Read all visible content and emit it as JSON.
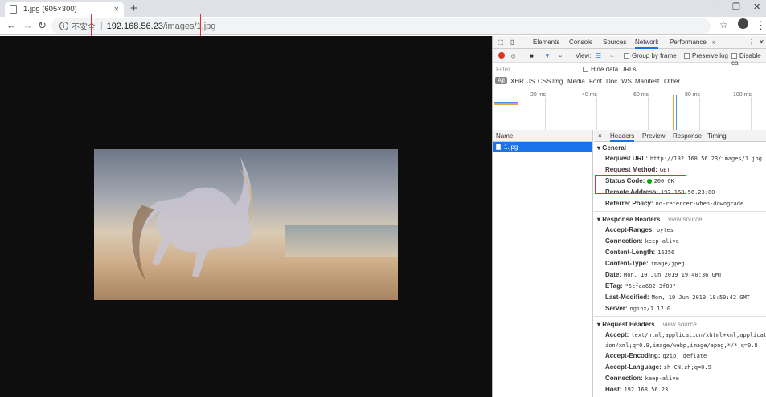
{
  "tab": {
    "title": "1.jpg (605×300)",
    "close": "×"
  },
  "newtab": "+",
  "window": {
    "minimize": "─",
    "restore": "❐",
    "close": "✕"
  },
  "toolbar": {
    "back": "←",
    "forward": "→",
    "reload": "↻",
    "insecure": "不安全",
    "separator": "|",
    "url_host": "192.168.56.23",
    "url_path": "/images/1.jpg",
    "star": "☆",
    "menu": "⋮"
  },
  "devtools": {
    "tabs": [
      "Elements",
      "Console",
      "Sources",
      "Network",
      "Performance",
      "»"
    ],
    "view_label": "View:",
    "group_by_frame": "Group by frame",
    "preserve_log": "Preserve log",
    "disable_cache": "Disable ca",
    "filter_placeholder": "Filter",
    "hide_data_urls": "Hide data URLs",
    "types": [
      "All",
      "XHR",
      "JS",
      "CSS",
      "Img",
      "Media",
      "Font",
      "Doc",
      "WS",
      "Manifest",
      "Other"
    ],
    "overview_ticks": [
      "20 ms",
      "40 ms",
      "60 ms",
      "80 ms",
      "100 ms"
    ],
    "name_header": "Name",
    "request_name": "1.jpg",
    "detail_tabs": [
      "×",
      "Headers",
      "Preview",
      "Response",
      "Timing"
    ],
    "general": {
      "title": "▾ General",
      "request_url_k": "Request URL:",
      "request_url_v": "http://192.168.56.23/images/1.jpg",
      "request_method_k": "Request Method:",
      "request_method_v": "GET",
      "status_code_k": "Status Code:",
      "status_code_v": "200 OK",
      "remote_address_k": "Remote Address:",
      "remote_address_v": "192.168.56.23:80",
      "referrer_policy_k": "Referrer Policy:",
      "referrer_policy_v": "no-referrer-when-downgrade"
    },
    "response_headers": {
      "title": "▾ Response Headers",
      "view_source": "view source",
      "accept_ranges_k": "Accept-Ranges:",
      "accept_ranges_v": "bytes",
      "connection_k": "Connection:",
      "connection_v": "keep-alive",
      "content_length_k": "Content-Length:",
      "content_length_v": "16256",
      "content_type_k": "Content-Type:",
      "content_type_v": "image/jpeg",
      "date_k": "Date:",
      "date_v": "Mon, 10 Jun 2019 19:40:36 GMT",
      "etag_k": "ETag:",
      "etag_v": "\"5cfea682-3f80\"",
      "last_modified_k": "Last-Modified:",
      "last_modified_v": "Mon, 10 Jun 2019 18:50:42 GMT",
      "server_k": "Server:",
      "server_v": "nginx/1.12.0"
    },
    "request_headers": {
      "title": "▾ Request Headers",
      "view_source": "view source",
      "accept_k": "Accept:",
      "accept_v1": "text/html,application/xhtml+xml,applicat",
      "accept_v2": "ion/xml;q=0.9,image/webp,image/apng,*/*;q=0.8",
      "accept_encoding_k": "Accept-Encoding:",
      "accept_encoding_v": "gzip, deflate",
      "accept_language_k": "Accept-Language:",
      "accept_language_v": "zh-CN,zh;q=0.9",
      "connection_k": "Connection:",
      "connection_v": "keep-alive",
      "host_k": "Host:",
      "host_v": "192.168.56.23"
    }
  }
}
